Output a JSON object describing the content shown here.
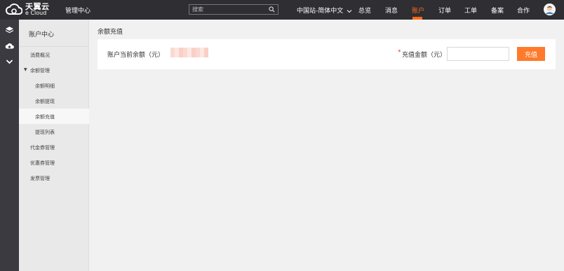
{
  "header": {
    "logo_cn": "天翼云",
    "logo_en": "e Cloud",
    "console_label": "管理中心",
    "search_placeholder": "搜索",
    "nav": [
      {
        "label": "中国站-简体中文",
        "icon": "chevron-down-icon"
      },
      {
        "label": "总览"
      },
      {
        "label": "消息"
      },
      {
        "label": "账户",
        "active": true
      },
      {
        "label": "订单"
      },
      {
        "label": "工单"
      },
      {
        "label": "备案"
      },
      {
        "label": "合作"
      }
    ],
    "accent_color": "#ff6a1a"
  },
  "rail": {
    "icons": [
      "layers-icon",
      "cloud-icon",
      "chevron-down-icon"
    ]
  },
  "sidebar": {
    "title": "账户中心",
    "items": [
      {
        "label": "消费概况"
      },
      {
        "label": "余额管理",
        "expanded": true
      },
      {
        "label": "余额明细",
        "child": true
      },
      {
        "label": "余额提现",
        "child": true
      },
      {
        "label": "余额充值",
        "child": true,
        "active": true
      },
      {
        "label": "提现列表",
        "child": true
      },
      {
        "label": "代金券管理"
      },
      {
        "label": "优惠券管理"
      },
      {
        "label": "发票管理"
      }
    ]
  },
  "main": {
    "title": "余额充值",
    "balance_label": "账户当前余额（元）",
    "balance_value": "",
    "amount_label": "充值金额（元）",
    "required_mark": "*",
    "amount_value": "",
    "charge_button": "充值"
  }
}
